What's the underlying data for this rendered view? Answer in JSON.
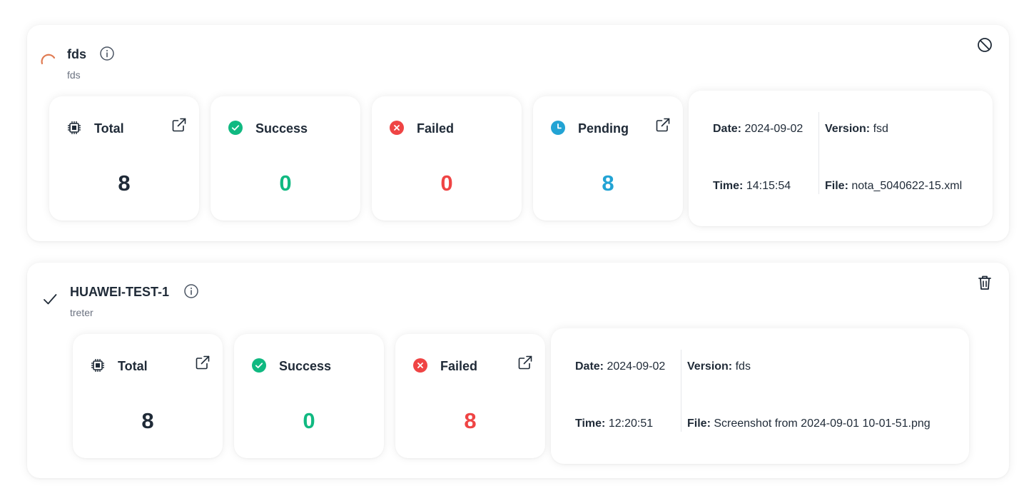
{
  "jobs": [
    {
      "status": "in-progress",
      "status_icon": "spinner-icon",
      "title": "fds",
      "subtitle": "fds",
      "corner_action_icon": "cancel-icon",
      "stats": {
        "total": {
          "label": "Total",
          "value": "8"
        },
        "success": {
          "label": "Success",
          "value": "0"
        },
        "failed": {
          "label": "Failed",
          "value": "0"
        },
        "pending": {
          "label": "Pending",
          "value": "8"
        }
      },
      "meta": {
        "date_label": "Date:",
        "date": "2024-09-02",
        "time_label": "Time:",
        "time": "14:15:54",
        "version_label": "Version:",
        "version": "fsd",
        "file_label": "File:",
        "file": "nota_5040622-15.xml"
      }
    },
    {
      "status": "completed",
      "status_icon": "check-icon",
      "title": "HUAWEI-TEST-1",
      "subtitle": "treter",
      "corner_action_icon": "trash-icon",
      "stats": {
        "total": {
          "label": "Total",
          "value": "8"
        },
        "success": {
          "label": "Success",
          "value": "0"
        },
        "failed": {
          "label": "Failed",
          "value": "8"
        }
      },
      "meta": {
        "date_label": "Date:",
        "date": "2024-09-02",
        "time_label": "Time:",
        "time": "12:20:51",
        "version_label": "Version:",
        "version": "fds",
        "file_label": "File:",
        "file": "Screenshot from 2024-09-01 10-01-51.png"
      }
    }
  ],
  "colors": {
    "success": "#10b981",
    "failed": "#ef4444",
    "pending": "#22a3d4",
    "spinner": "#e07b52",
    "text": "#1f2a37",
    "muted": "#6b7280"
  }
}
